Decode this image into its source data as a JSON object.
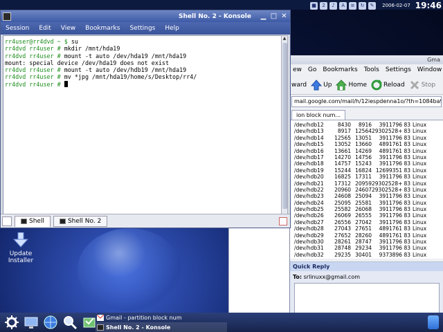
{
  "desktop": {
    "icon_label_line1": "Update",
    "icon_label_line2": "Installer"
  },
  "tray": {
    "date": "2006-02-07",
    "clock": "19:46"
  },
  "konsole": {
    "title": "Shell No. 2 - Konsole",
    "menu": [
      "Session",
      "Edit",
      "View",
      "Bookmarks",
      "Settings",
      "Help"
    ],
    "lines": [
      {
        "prompt": "rr4user@rr4dvd ~ $ ",
        "text": "su"
      },
      {
        "prompt": "rr4dvd rr4user # ",
        "text": "mkdir /mnt/hda19"
      },
      {
        "prompt": "rr4dvd rr4user # ",
        "text": "mount -t auto /dev/hda19 /mnt/hda19"
      },
      {
        "prompt": "",
        "text": "mount: special device /dev/hda19 does not exist"
      },
      {
        "prompt": "rr4dvd rr4user # ",
        "text": "mount -t auto /dev/hdb19 /mnt/hda19"
      },
      {
        "prompt": "rr4dvd rr4user # ",
        "text": "mv *jpg /mnt/hda19/home/s/Desktop/rr4/"
      },
      {
        "prompt": "rr4dvd rr4user # ",
        "text": ""
      }
    ],
    "tabs": [
      "Shell",
      "Shell No. 2"
    ]
  },
  "browser": {
    "title_fragment": "Gma",
    "menu": [
      "ew",
      "Go",
      "Bookmarks",
      "Tools",
      "Settings",
      "Window"
    ],
    "toolbar": {
      "forward": "ward",
      "up": "Up",
      "home": "Home",
      "reload": "Reload",
      "stop": "Stop"
    },
    "url": "mail.google.com/mail/h/12iespdenna1o/?th=1084ba966",
    "tab": "ion block num...",
    "partitions": [
      [
        "/dev/hdb12",
        "8430",
        "8916",
        "3911796",
        "83",
        "Linux"
      ],
      [
        "/dev/hdb13",
        "8917",
        "12564",
        "29302528+",
        "83",
        "Linux"
      ],
      [
        "/dev/hdb14",
        "12565",
        "13051",
        "3911796",
        "83",
        "Linux"
      ],
      [
        "/dev/hdb15",
        "13052",
        "13660",
        "4891761",
        "83",
        "Linux"
      ],
      [
        "/dev/hdb16",
        "13661",
        "14269",
        "4891761",
        "83",
        "Linux"
      ],
      [
        "/dev/hdb17",
        "14270",
        "14756",
        "3911796",
        "83",
        "Linux"
      ],
      [
        "/dev/hdb18",
        "14757",
        "15243",
        "3911796",
        "83",
        "Linux"
      ],
      [
        "/dev/hdb19",
        "15244",
        "16824",
        "12699351",
        "83",
        "Linux"
      ],
      [
        "/dev/hdb20",
        "16825",
        "17311",
        "3911796",
        "83",
        "Linux"
      ],
      [
        "/dev/hdb21",
        "17312",
        "20959",
        "29302528+",
        "83",
        "Linux"
      ],
      [
        "/dev/hdb22",
        "20960",
        "24607",
        "29302528+",
        "83",
        "Linux"
      ],
      [
        "/dev/hdb23",
        "24608",
        "25094",
        "3911796",
        "83",
        "Linux"
      ],
      [
        "/dev/hdb24",
        "25095",
        "25581",
        "3911796",
        "83",
        "Linux"
      ],
      [
        "/dev/hdb25",
        "25582",
        "26068",
        "3911796",
        "83",
        "Linux"
      ],
      [
        "/dev/hdb26",
        "26069",
        "26555",
        "3911796",
        "83",
        "Linux"
      ],
      [
        "/dev/hdb27",
        "26556",
        "27042",
        "3911796",
        "83",
        "Linux"
      ],
      [
        "/dev/hdb28",
        "27043",
        "27651",
        "4891761",
        "83",
        "Linux"
      ],
      [
        "/dev/hdb29",
        "27652",
        "28260",
        "4891761",
        "83",
        "Linux"
      ],
      [
        "/dev/hdb30",
        "28261",
        "28747",
        "3911796",
        "83",
        "Linux"
      ],
      [
        "/dev/hdb31",
        "28748",
        "29234",
        "3911796",
        "83",
        "Linux"
      ],
      [
        "/dev/hdb32",
        "29235",
        "30401",
        "9373896",
        "83",
        "Linux"
      ]
    ],
    "quick_reply": {
      "heading": "Quick Reply",
      "to_label": "To:",
      "to_value": "srlinuxx@gmail.com"
    }
  },
  "taskbar": {
    "tasks": [
      "Gmail - partition block num",
      "Shell No. 2 - Konsole"
    ]
  }
}
